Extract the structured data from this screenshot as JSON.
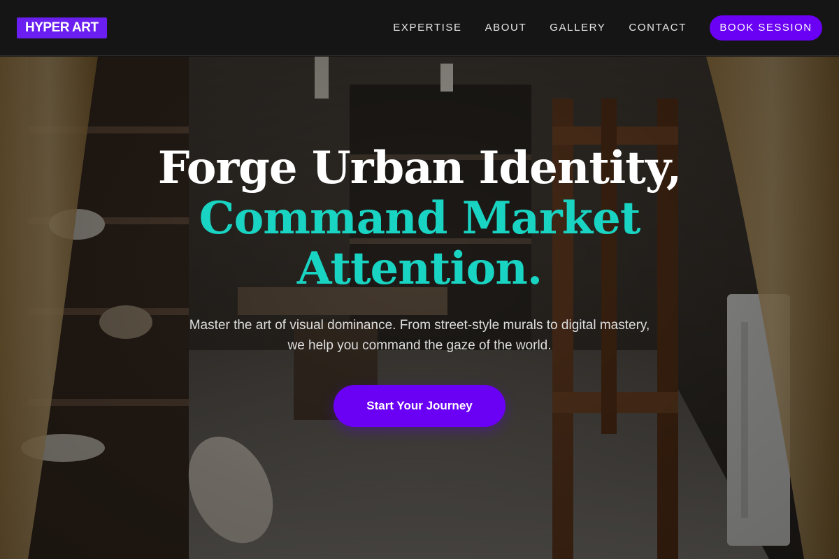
{
  "header": {
    "logo": "HYPER ART",
    "nav": [
      "EXPERTISE",
      "ABOUT",
      "GALLERY",
      "CONTACT"
    ],
    "book_label": "BOOK SESSION"
  },
  "hero": {
    "headline_line1": "Forge Urban Identity,",
    "headline_line2": "Command Market",
    "headline_line3": "Attention.",
    "subhead": "Master the art of visual dominance. From street-style murals to digital mastery, we help you command the gaze of the world.",
    "cta_label": "Start Your Journey",
    "background": "art-studio-photo"
  },
  "colors": {
    "accent": "#6a00f4",
    "teal": "#19d4c2",
    "header_bg": "#151515"
  }
}
